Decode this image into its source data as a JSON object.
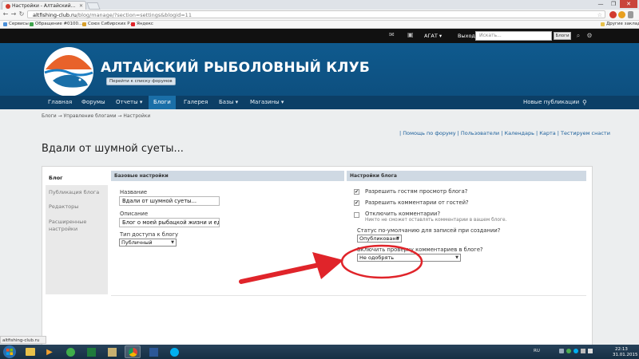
{
  "browser": {
    "tab_title": "Настройки - Алтайский...",
    "url_host": "altfishing-club.ru",
    "url_path": "/blog/manage/?section=settings&blogid=11",
    "bookmarks": [
      "Сервисы",
      "Обращение #0100...",
      "Союз Сибирских Р...",
      "Яндекс"
    ],
    "other_bookmarks": "Другие закладки",
    "status_url": "altfishing-club.ru"
  },
  "header": {
    "user": "АГАТ ▾",
    "exit": "Выход",
    "search_placeholder": "Искать...",
    "search_scope": "Блоги"
  },
  "site": {
    "name": "АЛТАЙСКИЙ РЫБОЛОВНЫЙ КЛУБ",
    "forum_list_link": "Перейти к списку форумов"
  },
  "nav": {
    "items": [
      "Главная",
      "Форумы",
      "Отчеты ▾",
      "Блоги",
      "Галерея",
      "Базы ▾",
      "Магазины ▾"
    ],
    "new_posts": "Новые публикации"
  },
  "breadcrumbs": "Блоги → Управление блогами → Настройки",
  "top_links": "| Помощь по форуму | Пользователи | Календарь | Карта | Тестируем снасти",
  "page_title": "Вдали от шумной суеты...",
  "sidebar": {
    "items": [
      "Блог",
      "Публикация блога",
      "Редакторы",
      "Расширенные настройки"
    ]
  },
  "basic_settings": {
    "header": "Базовые настройки",
    "name_label": "Название",
    "name_value": "Вдали от шумной суеты...",
    "description_label": "Описание",
    "description_value": "Блог о моей рыбацкой жизни и единен",
    "access_label": "Тип доступа к блогу",
    "access_value": "Публичный"
  },
  "blog_settings": {
    "header": "Настройки блога",
    "allow_guests": "Разрешить гостям просмотр блога?",
    "allow_guest_comments": "Разрешить комментарии от гостей?",
    "disable_comments": "Отключить комментарии?",
    "disable_comments_hint": "Никто не сможет оставлять комментарии в вашем блоге.",
    "default_status_label": "Статус по-умолчанию для записей при создании?",
    "default_status_value": "Опубликовано",
    "moderation_label": "Включить проверку комментариев в блоге?",
    "moderation_value": "Не одобрять"
  },
  "taskbar": {
    "lang": "RU",
    "time": "22:13",
    "date": "31.01.2015"
  },
  "colors": {
    "banner": "#0f5a8e",
    "nav": "#0c3f66",
    "nav_active": "#1a6fa8",
    "annotation": "#e0242a"
  }
}
